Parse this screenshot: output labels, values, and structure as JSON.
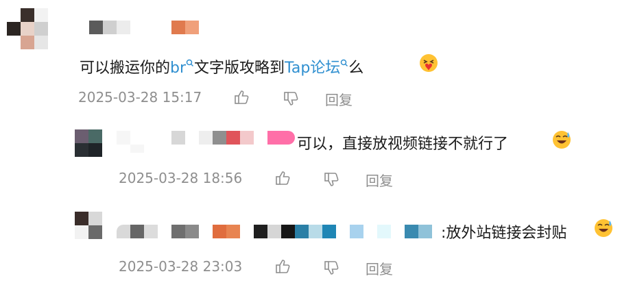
{
  "comments": [
    {
      "text_before_link1": "可以搬运你的",
      "link1": "br",
      "text_mid": "文字版攻略到",
      "link2": "Tap论坛",
      "text_end": "么",
      "emoji": "heart-hug-emoji",
      "timestamp": "2025-03-28 15:17",
      "reply_label": "回复"
    },
    {
      "text": "可以，直接放视频链接不就行了",
      "emoji": "sweat-smile-emoji",
      "timestamp": "2025-03-28 18:56",
      "reply_label": "回复"
    },
    {
      "text": ":放外站链接会封贴",
      "emoji": "sweat-smile-emoji",
      "timestamp": "2025-03-28 23:03",
      "reply_label": "回复"
    }
  ],
  "icons": {
    "like": "thumbs-up-icon",
    "dislike": "thumbs-down-icon",
    "search_superscript": "magnifier-icon"
  },
  "colors": {
    "link": "#2f8fd0",
    "meta": "#8e8e8e",
    "text": "#1a1a1a"
  }
}
